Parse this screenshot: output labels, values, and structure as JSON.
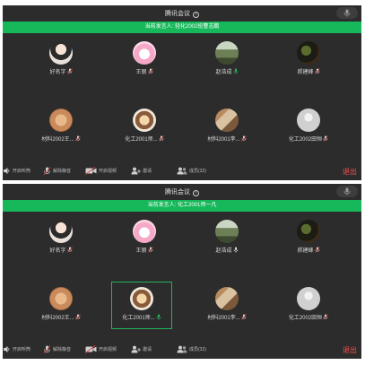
{
  "meeting_title": "腾讯会议",
  "screens": [
    {
      "speaker_banner": "当前发言人: 轻化2002班曹志鹏",
      "toolbar": {
        "speaker": "开启听筒",
        "unmute": "解除静音",
        "video": "开启视频",
        "invite": "邀请",
        "members": "成员(32)",
        "exit": "退出"
      },
      "participants": [
        {
          "name": "好名字",
          "mic": "muted",
          "avatar": "girl-photo"
        },
        {
          "name": "王丽",
          "mic": "muted",
          "avatar": "cartoon-pink"
        },
        {
          "name": "赵浩成",
          "mic": "active",
          "avatar": "landscape-photo"
        },
        {
          "name": "郝建峰",
          "mic": "muted",
          "avatar": "dark-photo"
        },
        {
          "name": "材料2002王...",
          "mic": "muted",
          "avatar": "cat-photo"
        },
        {
          "name": "化工2001师...",
          "mic": "muted",
          "avatar": "cartoon-cat"
        },
        {
          "name": "材料2001李...",
          "mic": "muted",
          "avatar": "people-photo"
        },
        {
          "name": "化工2002田恒",
          "mic": "muted",
          "avatar": "default-user"
        }
      ]
    },
    {
      "speaker_banner": "当前发言人: 化工2001师一凡",
      "toolbar": {
        "speaker": "开启听筒",
        "unmute": "解除静音",
        "video": "开启视频",
        "invite": "邀请",
        "members": "成员(32)",
        "exit": "退出"
      },
      "participants": [
        {
          "name": "好名字",
          "mic": "muted",
          "avatar": "girl-photo"
        },
        {
          "name": "王丽",
          "mic": "muted",
          "avatar": "cartoon-pink"
        },
        {
          "name": "赵浩成",
          "mic": "off",
          "avatar": "landscape-photo"
        },
        {
          "name": "郝建峰",
          "mic": "muted",
          "avatar": "dark-photo"
        },
        {
          "name": "材料2002王...",
          "mic": "muted",
          "avatar": "cat-photo"
        },
        {
          "name": "化工2001师...",
          "mic": "active",
          "avatar": "cartoon-cat",
          "speaking": true
        },
        {
          "name": "材料2001李...",
          "mic": "muted",
          "avatar": "people-photo"
        },
        {
          "name": "化工2002田恒",
          "mic": "muted",
          "avatar": "default-user"
        }
      ]
    }
  ],
  "colors": {
    "background": "#2c2c2c",
    "banner": "#16b85a",
    "muted_mic": "#e04646",
    "active_mic": "#25c05e",
    "exit": "#ff4b4b"
  }
}
